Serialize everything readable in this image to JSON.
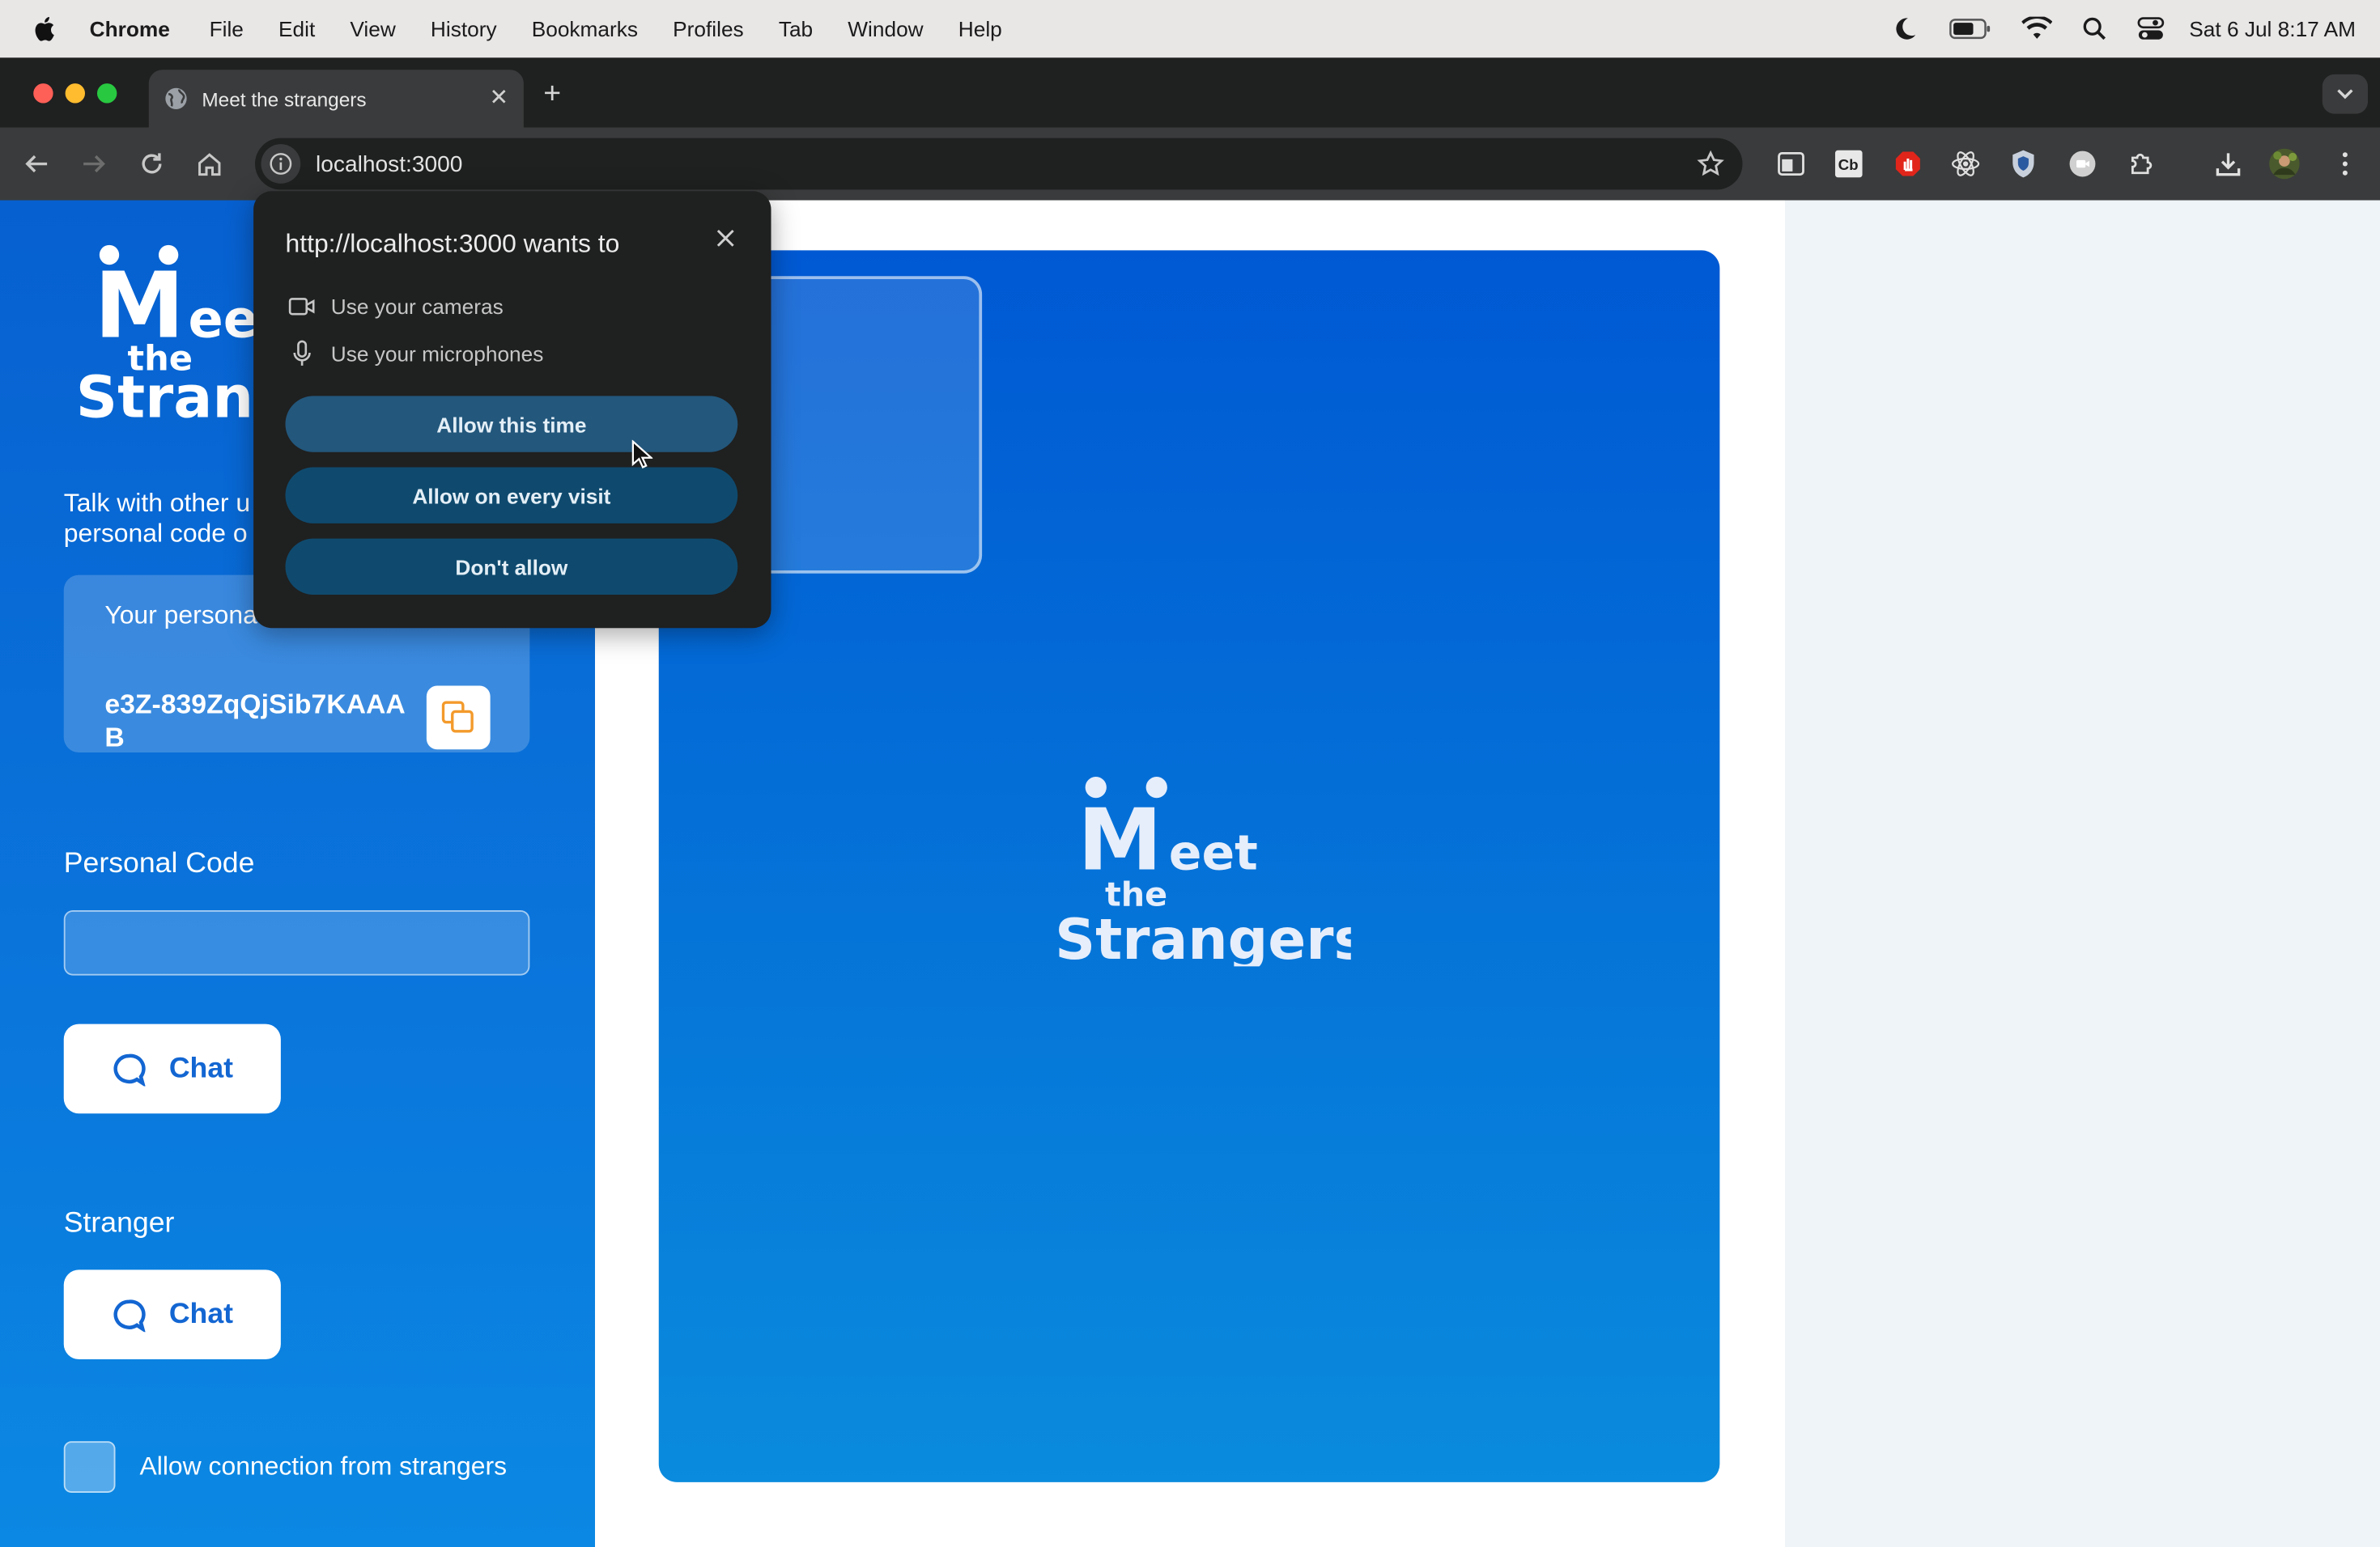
{
  "menubar": {
    "app": "Chrome",
    "items": [
      "File",
      "Edit",
      "View",
      "History",
      "Bookmarks",
      "Profiles",
      "Tab",
      "Window",
      "Help"
    ],
    "clock": "Sat 6 Jul  8:17 AM",
    "icons": [
      "apple-icon",
      "moon-icon",
      "battery-icon",
      "wifi-icon",
      "spotlight-icon",
      "control-center-icon"
    ]
  },
  "tabs": [
    {
      "title": "Meet the strangers",
      "active": true
    }
  ],
  "toolbar": {
    "url": "localhost:3000",
    "extensions": [
      "sidebar-icon",
      "cb-extension-icon",
      "adblock-icon",
      "react-devtools-icon",
      "shield-extension-icon",
      "record-extension-icon",
      "puzzle-icon",
      "download-icon",
      "profile-avatar",
      "kebab-menu-icon"
    ]
  },
  "sidebar": {
    "logo": {
      "line1": "M",
      "line1_rest": "ee",
      "line2": "the",
      "line3": "Strang"
    },
    "intro": "Talk with other u\npersonal code o",
    "code_label": "Your persona",
    "code_value": "e3Z-839ZqQjSib7KAAAB",
    "personal_code_label": "Personal Code",
    "personal_code_input": "",
    "chat_label": "Chat",
    "stranger_label": "Stranger",
    "stranger_chat_label": "Chat",
    "allow_label": "Allow connection from strangers",
    "allow_checked": false
  },
  "video": {
    "logo": {
      "line1": "M",
      "line1_rest": "eet",
      "line2": "the",
      "line3": "Strangers"
    }
  },
  "permission_prompt": {
    "title": "http://localhost:3000 wants to",
    "items": [
      "Use your cameras",
      "Use your microphones"
    ],
    "buttons": [
      "Allow this time",
      "Allow on every visit",
      "Don't allow"
    ]
  },
  "colors": {
    "sidebar_top": "#0760d0",
    "video_top": "#0059d3",
    "chat_text": "#1366d2",
    "popup_bg": "#1f2020",
    "copy_icon": "#f39a2b"
  }
}
